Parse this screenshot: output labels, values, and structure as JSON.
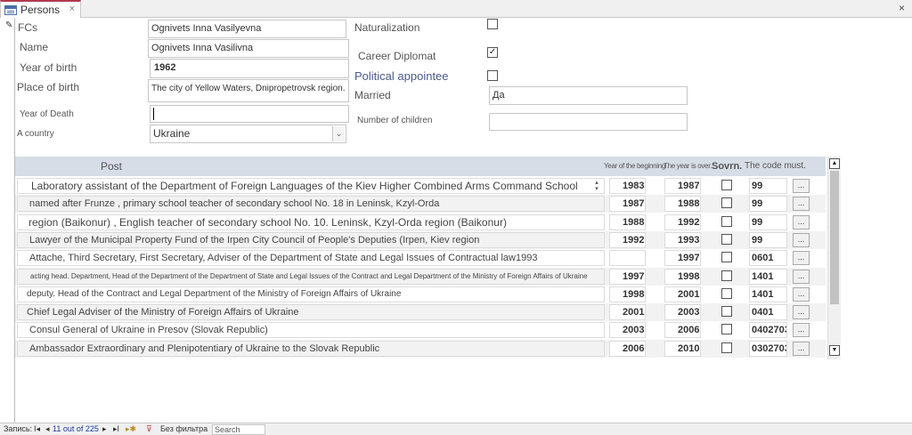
{
  "tab": {
    "title": "Persons",
    "close": "×"
  },
  "window_close": "×",
  "form": {
    "fcs": {
      "label": "FCs",
      "value": "Ognivets Inna Vasilyevna"
    },
    "name": {
      "label": "Name",
      "value": "Ognivets Inna Vasilivna"
    },
    "year_of_birth": {
      "label": "Year of birth",
      "value": "1962"
    },
    "place_of_birth": {
      "label": "Place of birth",
      "value": "The city of Yellow Waters, Dnipropetrovsk region."
    },
    "year_of_death": {
      "label": "Year of Death",
      "value": ""
    },
    "country": {
      "label": "A country",
      "value": "Ukraine"
    },
    "naturalization": {
      "label": "Naturalization",
      "checked": false
    },
    "career_diplomat": {
      "label": "Career Diplomat",
      "checked": true
    },
    "political_appointee": {
      "label": "Political appointee",
      "checked": false
    },
    "married": {
      "label": "Married",
      "value": "Да"
    },
    "children": {
      "label": "Number of children",
      "value": ""
    }
  },
  "subform": {
    "headers": {
      "post": "Post",
      "year_begin": "Year of the beginning .",
      "year_over": "The year is over.",
      "sovrn": "Sovrn.",
      "code": "The code must."
    },
    "rows": [
      {
        "post": "Laboratory assistant of the Department of Foreign Languages of the Kiev Higher Combined Arms Command School",
        "begin": "1983",
        "end": "1987",
        "code": "99",
        "dots": "..."
      },
      {
        "post": "named after Frunze , primary school teacher of secondary school No. 18 in Leninsk, Kzyl-Orda",
        "begin": "1987",
        "end": "1988",
        "code": "99",
        "dots": "..."
      },
      {
        "post": "region (Baikonur) , English teacher of secondary school No. 10. Leninsk, Kzyl-Orda region (Baikonur)",
        "begin": "1988",
        "end": "1992",
        "code": "99",
        "dots": "..."
      },
      {
        "post": "Lawyer of the Municipal Property Fund of the Irpen City Council of People's Deputies (Irpen, Kiev region",
        "begin": "1992",
        "end": "1993",
        "code": "99",
        "dots": "..."
      },
      {
        "post": "Attache, Third Secretary, First Secretary, Adviser of the Department of State and Legal Issues of Contractual law1993",
        "begin": "",
        "end": "1997",
        "code": "0601",
        "dots": "..."
      },
      {
        "post": "acting head. Department, Head of the Department of the Department of State and Legal Issues of the Contract and Legal Department of the Ministry of Foreign Affairs of Ukraine",
        "begin": "1997",
        "end": "1998",
        "code": "1401",
        "dots": "..."
      },
      {
        "post": "deputy. Head of the Contract and Legal Department of the Ministry of Foreign Affairs of Ukraine",
        "begin": "1998",
        "end": "2001",
        "code": "1401",
        "dots": "..."
      },
      {
        "post": "Chief Legal Adviser of the Ministry of Foreign Affairs of Ukraine",
        "begin": "2001",
        "end": "2003",
        "code": "0401",
        "dots": "..."
      },
      {
        "post": "Consul General of Ukraine in Presov (Slovak Republic)",
        "begin": "2003",
        "end": "2006",
        "code": "0402703",
        "dots": "..."
      },
      {
        "post": "Ambassador Extraordinary and Plenipotentiary of Ukraine to the Slovak Republic",
        "begin": "2006",
        "end": "2010",
        "code": "0302703",
        "dots": "..."
      }
    ]
  },
  "navbar": {
    "record_label": "Запись:",
    "position": "11 out of 225",
    "filter": "Без фильтра",
    "search": "Search"
  }
}
